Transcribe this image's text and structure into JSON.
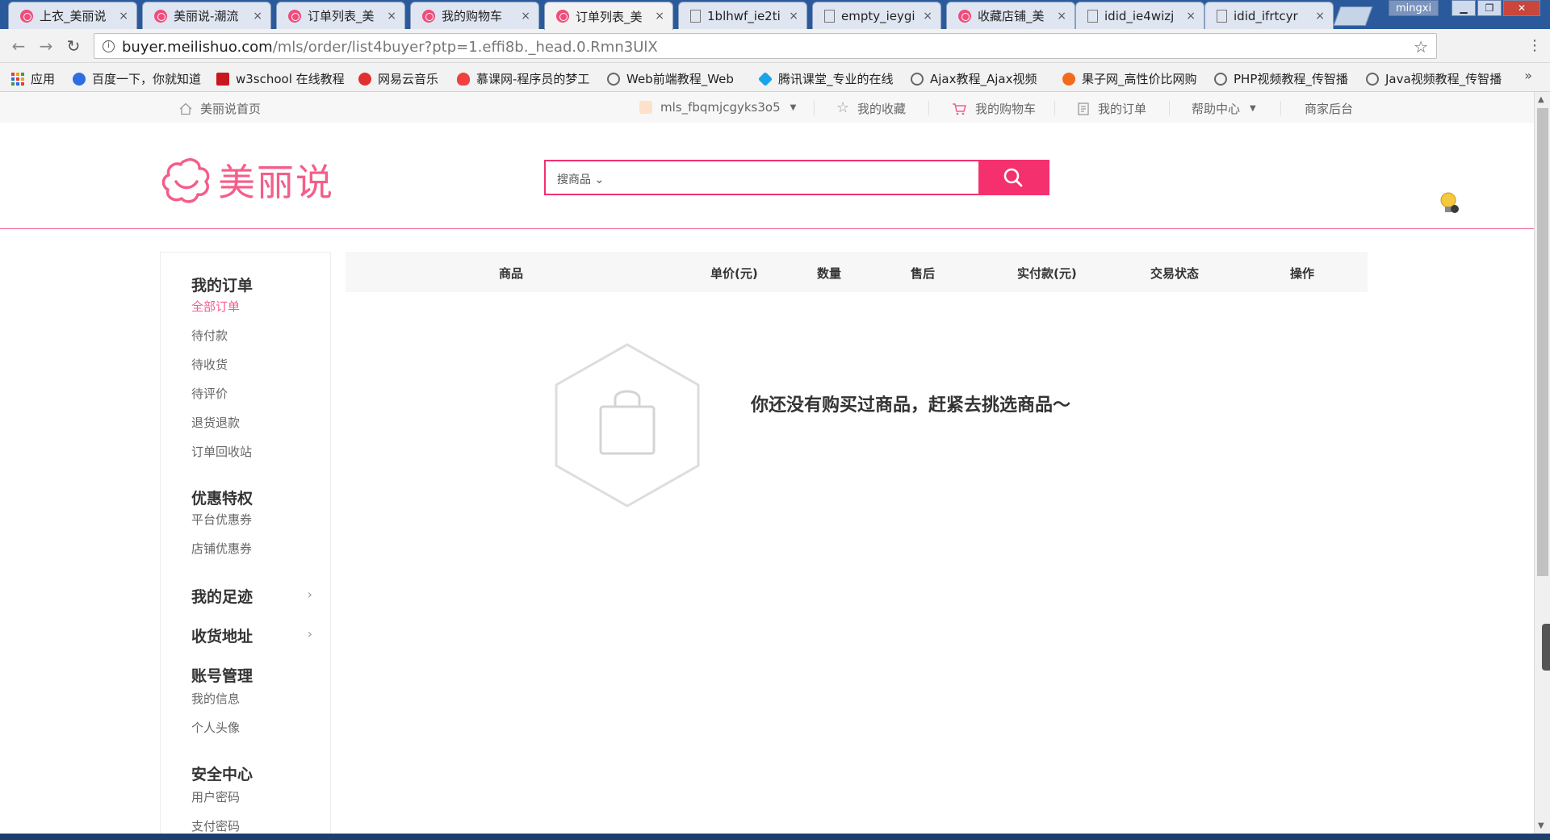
{
  "browser": {
    "tabs": [
      {
        "title": "上衣_美丽说",
        "icon": "meilishuo-icon"
      },
      {
        "title": "美丽说-潮流",
        "icon": "meilishuo-icon"
      },
      {
        "title": "订单列表_美",
        "icon": "meilishuo-icon"
      },
      {
        "title": "我的购物车",
        "icon": "meilishuo-icon"
      },
      {
        "title": "订单列表_美",
        "icon": "meilishuo-icon",
        "active": true
      },
      {
        "title": "1blhwf_ie2ti",
        "icon": "document-icon"
      },
      {
        "title": "empty_ieygi",
        "icon": "document-icon"
      },
      {
        "title": "收藏店铺_美",
        "icon": "meilishuo-icon"
      },
      {
        "title": "idid_ie4wizj",
        "icon": "document-icon"
      },
      {
        "title": "idid_ifrtcyr",
        "icon": "document-icon"
      }
    ],
    "tab_close": "×",
    "window_user": "mingxi",
    "address": {
      "host": "buyer.meilishuo.com",
      "path": "/mls/order/list4buyer?ptp=1.effi8b._head.0.Rmn3UlX"
    },
    "bookmarks": [
      {
        "label": "应用",
        "icon": "apps-grid-icon"
      },
      {
        "label": "百度一下，你就知道",
        "icon": "baidu-paw-icon",
        "color": "#2f6ee0"
      },
      {
        "label": "w3school 在线教程",
        "icon": "w3school-icon",
        "color": "#c9171e"
      },
      {
        "label": "网易云音乐",
        "icon": "netease-music-icon",
        "color": "#e03030"
      },
      {
        "label": "慕课网-程序员的梦工",
        "icon": "imooc-flame-icon",
        "color": "#f04040"
      },
      {
        "label": "Web前端教程_Web",
        "icon": "globe-icon",
        "color": "#666666"
      },
      {
        "label": "腾讯课堂_专业的在线",
        "icon": "tencent-class-icon",
        "color": "#1aa4e8"
      },
      {
        "label": "Ajax教程_Ajax视频",
        "icon": "globe-icon",
        "color": "#666666"
      },
      {
        "label": "果子网_高性价比网购",
        "icon": "orange-fruit-icon",
        "color": "#f26b1d"
      },
      {
        "label": "PHP视频教程_传智播",
        "icon": "globe-icon",
        "color": "#666666"
      },
      {
        "label": "Java视频教程_传智播",
        "icon": "globe-icon",
        "color": "#666666"
      }
    ],
    "bookmarks_more": "»"
  },
  "site": {
    "accent": "#f45e8a",
    "search_button_color": "#f4306f",
    "topbar": {
      "home": "美丽说首页",
      "username": "mls_fbqmjcgyks3o5",
      "favorites": "我的收藏",
      "cart": "我的购物车",
      "orders": "我的订单",
      "help": "帮助中心",
      "merchant": "商家后台"
    },
    "logo_text": "美丽说",
    "search": {
      "dropdown": "搜商品",
      "value": ""
    },
    "sidebar": {
      "sections": [
        {
          "title": "我的订单",
          "items": [
            "全部订单",
            "待付款",
            "待收货",
            "待评价",
            "退货退款",
            "订单回收站"
          ],
          "active": 0
        },
        {
          "title": "优惠特权",
          "items": [
            "平台优惠券",
            "店铺优惠券"
          ]
        },
        {
          "title": "我的足迹",
          "expandable": true,
          "items": []
        },
        {
          "title": "收货地址",
          "expandable": true,
          "items": []
        },
        {
          "title": "账号管理",
          "items": [
            "我的信息",
            "个人头像"
          ]
        },
        {
          "title": "安全中心",
          "items": [
            "用户密码",
            "支付密码"
          ]
        }
      ]
    },
    "table_headers": [
      "商品",
      "单价(元)",
      "数量",
      "售后",
      "实付款(元)",
      "交易状态",
      "操作"
    ],
    "empty_message": "你还没有购买过商品，赶紧去挑选商品～"
  }
}
